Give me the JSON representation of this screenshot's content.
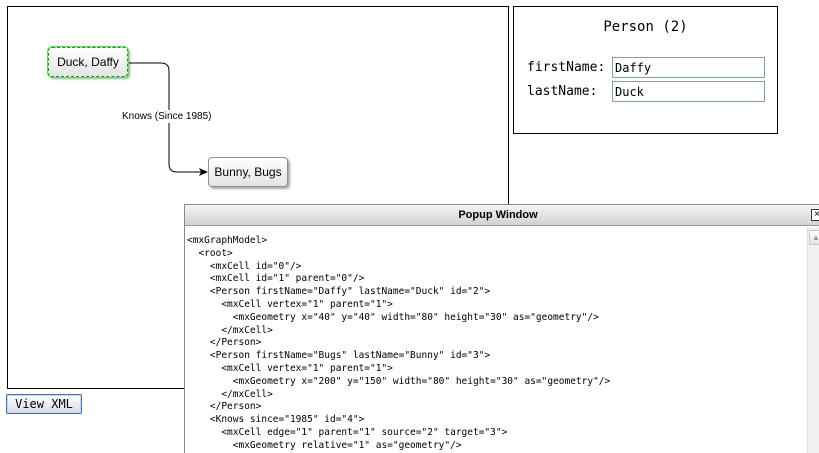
{
  "graph": {
    "nodes": [
      {
        "label": "Duck, Daffy"
      },
      {
        "label": "Bunny, Bugs"
      }
    ],
    "edge_label": "Knows (Since 1985)"
  },
  "properties": {
    "title": "Person (2)",
    "fields": [
      {
        "label": "firstName:",
        "value": "Daffy"
      },
      {
        "label": "lastName:",
        "value": "Duck"
      }
    ]
  },
  "view_xml_button": "View XML",
  "popup": {
    "title": "Popup Window",
    "close": "×",
    "xml_lines": [
      "<mxGraphModel>",
      "  <root>",
      "    <mxCell id=\"0\"/>",
      "    <mxCell id=\"1\" parent=\"0\"/>",
      "    <Person firstName=\"Daffy\" lastName=\"Duck\" id=\"2\">",
      "      <mxCell vertex=\"1\" parent=\"1\">",
      "        <mxGeometry x=\"40\" y=\"40\" width=\"80\" height=\"30\" as=\"geometry\"/>",
      "      </mxCell>",
      "    </Person>",
      "    <Person firstName=\"Bugs\" lastName=\"Bunny\" id=\"3\">",
      "      <mxCell vertex=\"1\" parent=\"1\">",
      "        <mxGeometry x=\"200\" y=\"150\" width=\"80\" height=\"30\" as=\"geometry\"/>",
      "      </mxCell>",
      "    </Person>",
      "    <Knows since=\"1985\" id=\"4\">",
      "      <mxCell edge=\"1\" parent=\"1\" source=\"2\" target=\"3\">",
      "        <mxGeometry relative=\"1\" as=\"geometry\"/>"
    ],
    "scroll_up_icon": "triangle-up"
  }
}
